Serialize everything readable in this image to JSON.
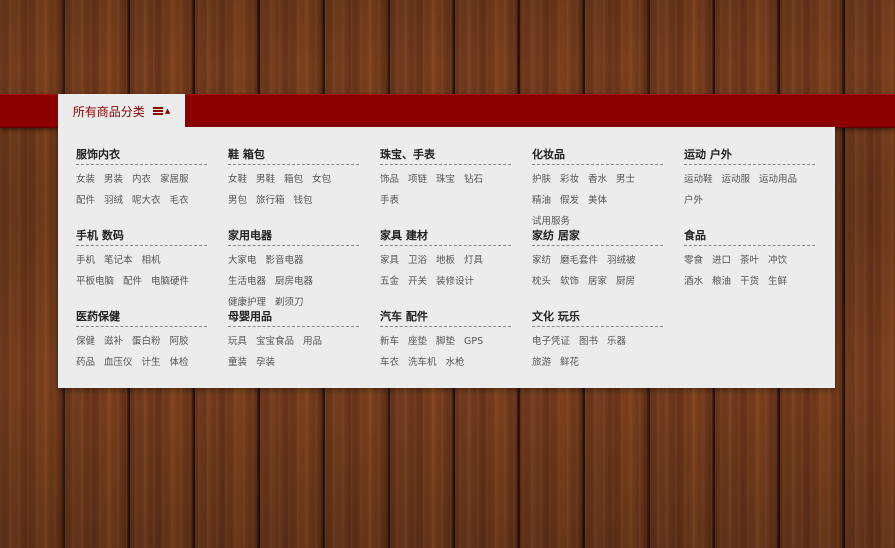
{
  "nav": {
    "all_categories_label": "所有商品分类",
    "menu_icon": "list-icon"
  },
  "categories": [
    {
      "title": "服饰内衣",
      "links": [
        "女装",
        "男装",
        "内衣",
        "家居服",
        "配件",
        "羽绒",
        "呢大衣",
        "毛衣"
      ]
    },
    {
      "title": "鞋 箱包",
      "links": [
        "女鞋",
        "男鞋",
        "箱包",
        "女包",
        "男包",
        "旅行箱",
        "钱包"
      ]
    },
    {
      "title": "珠宝、手表",
      "links": [
        "饰品",
        "项链",
        "珠宝",
        "钻石",
        "手表"
      ]
    },
    {
      "title": "化妆品",
      "links": [
        "护肤",
        "彩妆",
        "香水",
        "男士",
        "精油",
        "假发",
        "美体",
        "试用服务"
      ]
    },
    {
      "title": "运动 户外",
      "links": [
        "运动鞋",
        "运动服",
        "运动用品",
        "户外"
      ]
    },
    {
      "title": "手机 数码",
      "links": [
        "手机",
        "笔记本",
        "相机",
        "平板电脑",
        "配件",
        "电脑硬件"
      ]
    },
    {
      "title": "家用电器",
      "links": [
        "大家电",
        "影音电器",
        "生活电器",
        "厨房电器",
        "健康护理",
        "剃须刀"
      ]
    },
    {
      "title": "家具 建材",
      "links": [
        "家具",
        "卫浴",
        "地板",
        "灯具",
        "五金",
        "开关",
        "装修设计"
      ]
    },
    {
      "title": "家纺 居家",
      "links": [
        "家纺",
        "磨毛套件",
        "羽绒被",
        "枕头",
        "软饰",
        "居家",
        "厨房"
      ]
    },
    {
      "title": "食品",
      "links": [
        "零食",
        "进口",
        "茶叶",
        "冲饮",
        "酒水",
        "粮油",
        "干货",
        "生鲜"
      ]
    },
    {
      "title": "医药保健",
      "links": [
        "保健",
        "滋补",
        "蛋白粉",
        "阿胶",
        "药品",
        "血压仪",
        "计生",
        "体检"
      ]
    },
    {
      "title": "母婴用品",
      "links": [
        "玩具",
        "宝宝食品",
        "用品",
        "童装",
        "孕装"
      ]
    },
    {
      "title": "汽车 配件",
      "links": [
        "新车",
        "座垫",
        "脚垫",
        "GPS",
        "车衣",
        "洗车机",
        "水枪"
      ]
    },
    {
      "title": "文化 玩乐",
      "links": [
        "电子凭证",
        "图书",
        "乐器",
        "旅游",
        "鲜花"
      ]
    }
  ]
}
